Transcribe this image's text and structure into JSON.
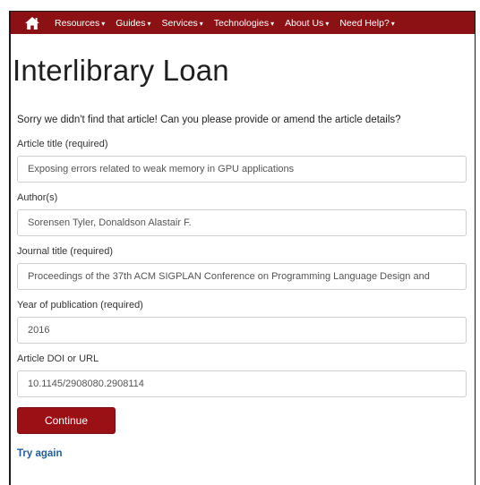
{
  "navbar": {
    "home_icon": "home-icon",
    "items": [
      {
        "label": "Resources",
        "caret": "▾"
      },
      {
        "label": "Guides",
        "caret": "▾"
      },
      {
        "label": "Services",
        "caret": "▾"
      },
      {
        "label": "Technologies",
        "caret": "▾"
      },
      {
        "label": "About Us",
        "caret": "▾"
      },
      {
        "label": "Need Help?",
        "caret": "▾"
      }
    ],
    "color": "#8b1115"
  },
  "page_title": "Interlibrary Loan",
  "intro": "Sorry we didn't find that article! Can you please provide or amend the article details?",
  "form": {
    "article_title": {
      "label": "Article title (required)",
      "value": "Exposing errors related to weak memory in GPU applications"
    },
    "authors": {
      "label": "Author(s)",
      "value": "Sorensen Tyler, Donaldson Alastair F."
    },
    "journal_title": {
      "label": "Journal title (required)",
      "value": "Proceedings of the 37th ACM SIGPLAN Conference on Programming Language Design and"
    },
    "year": {
      "label": "Year of publication (required)",
      "value": "2016"
    },
    "doi": {
      "label": "Article DOI or URL",
      "value": "10.1145/2908080.2908114"
    },
    "continue_label": "Continue",
    "try_again_label": "Try again"
  }
}
